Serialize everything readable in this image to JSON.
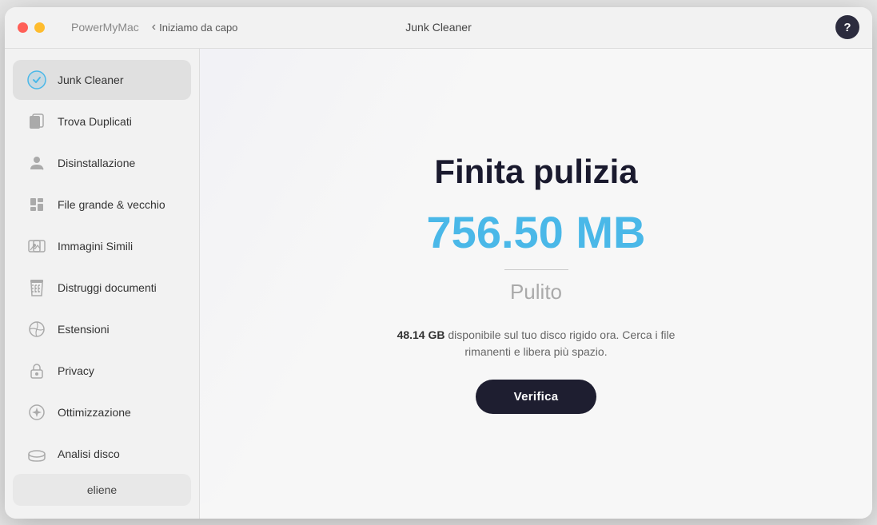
{
  "titleBar": {
    "appName": "PowerMyMac",
    "backLabel": "Iniziamo da capo",
    "windowTitle": "Junk Cleaner",
    "helpLabel": "?"
  },
  "sidebar": {
    "items": [
      {
        "id": "junk-cleaner",
        "label": "Junk Cleaner",
        "active": true
      },
      {
        "id": "trova-duplicati",
        "label": "Trova Duplicati",
        "active": false
      },
      {
        "id": "disinstallazione",
        "label": "Disinstallazione",
        "active": false
      },
      {
        "id": "file-grande",
        "label": "File grande & vecchio",
        "active": false
      },
      {
        "id": "immagini-simili",
        "label": "Immagini Simili",
        "active": false
      },
      {
        "id": "distruggi-documenti",
        "label": "Distruggi documenti",
        "active": false
      },
      {
        "id": "estensioni",
        "label": "Estensioni",
        "active": false
      },
      {
        "id": "privacy",
        "label": "Privacy",
        "active": false
      },
      {
        "id": "ottimizzazione",
        "label": "Ottimizzazione",
        "active": false
      },
      {
        "id": "analisi-disco",
        "label": "Analisi disco",
        "active": false
      }
    ],
    "userName": "eliene"
  },
  "content": {
    "finishTitle": "Finita pulizia",
    "cleanedAmount": "756.50 MB",
    "cleanedLabel": "Pulito",
    "diskInfo": {
      "size": "48.14 GB",
      "description": " disponibile sul tuo disco rigido ora. Cerca i file rimanenti e libera più spazio."
    },
    "verifyButton": "Verifica"
  }
}
